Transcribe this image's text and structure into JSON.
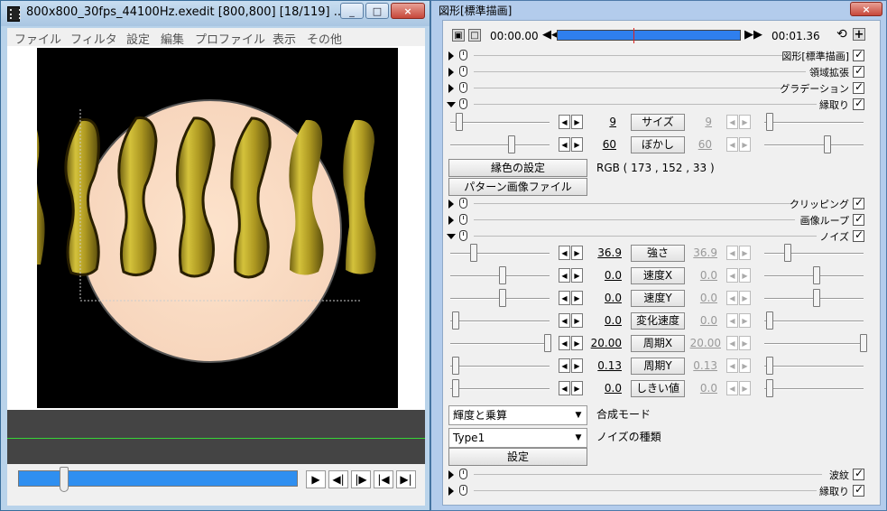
{
  "preview_window": {
    "title": "800x800_30fps_44100Hz.exedit  [800,800]  [18/119]  ...",
    "caption_buttons": [
      "_",
      "□",
      "×"
    ],
    "menu": [
      "ファイル",
      "フィルタ",
      "設定",
      "編集",
      "プロファイル",
      "表示",
      "その他"
    ],
    "nav_buttons": [
      "▶",
      "◀|",
      "|▶",
      "|◀",
      "▶|"
    ]
  },
  "settings_window": {
    "title": "図形[標準描画]",
    "close_label": "×",
    "time_start": "00:00.00",
    "time_end": "00:01.36",
    "timeline_position": 0.42,
    "sections_top": [
      {
        "label": "図形[標準描画]"
      },
      {
        "label": "領域拡張"
      },
      {
        "label": "グラデーション"
      },
      {
        "label": "縁取り"
      }
    ],
    "edge_params": [
      {
        "name": "サイズ",
        "value": "9",
        "end_value": "9"
      },
      {
        "name": "ぼかし",
        "value": "60",
        "end_value": "60"
      }
    ],
    "color_button": "縁色の設定",
    "rgb_text": "RGB ( 173 , 152 , 33 )",
    "pattern_button": "パターン画像ファイル",
    "sections_mid": [
      {
        "label": "クリッピング"
      },
      {
        "label": "画像ループ"
      },
      {
        "label": "ノイズ"
      }
    ],
    "noise_params": [
      {
        "name": "強さ",
        "value": "36.9",
        "end_value": "36.9"
      },
      {
        "name": "速度X",
        "value": "0.0",
        "end_value": "0.0"
      },
      {
        "name": "速度Y",
        "value": "0.0",
        "end_value": "0.0"
      },
      {
        "name": "変化速度",
        "value": "0.0",
        "end_value": "0.0"
      },
      {
        "name": "周期X",
        "value": "20.00",
        "end_value": "20.00"
      },
      {
        "name": "周期Y",
        "value": "0.13",
        "end_value": "0.13"
      },
      {
        "name": "しきい値",
        "value": "0.0",
        "end_value": "0.0"
      }
    ],
    "blend_select": "輝度と乗算",
    "blend_label": "合成モード",
    "noise_type_select": "Type1",
    "noise_type_label": "ノイズの種類",
    "settings_button": "設定",
    "sections_bottom": [
      {
        "label": "波紋"
      },
      {
        "label": "縁取り"
      }
    ]
  },
  "colors": {
    "edge_yellow": "#ad9821",
    "circle_fill": "#fde3cc",
    "timeline_blue": "#2f7fee",
    "desktop_green": "#57b957"
  }
}
